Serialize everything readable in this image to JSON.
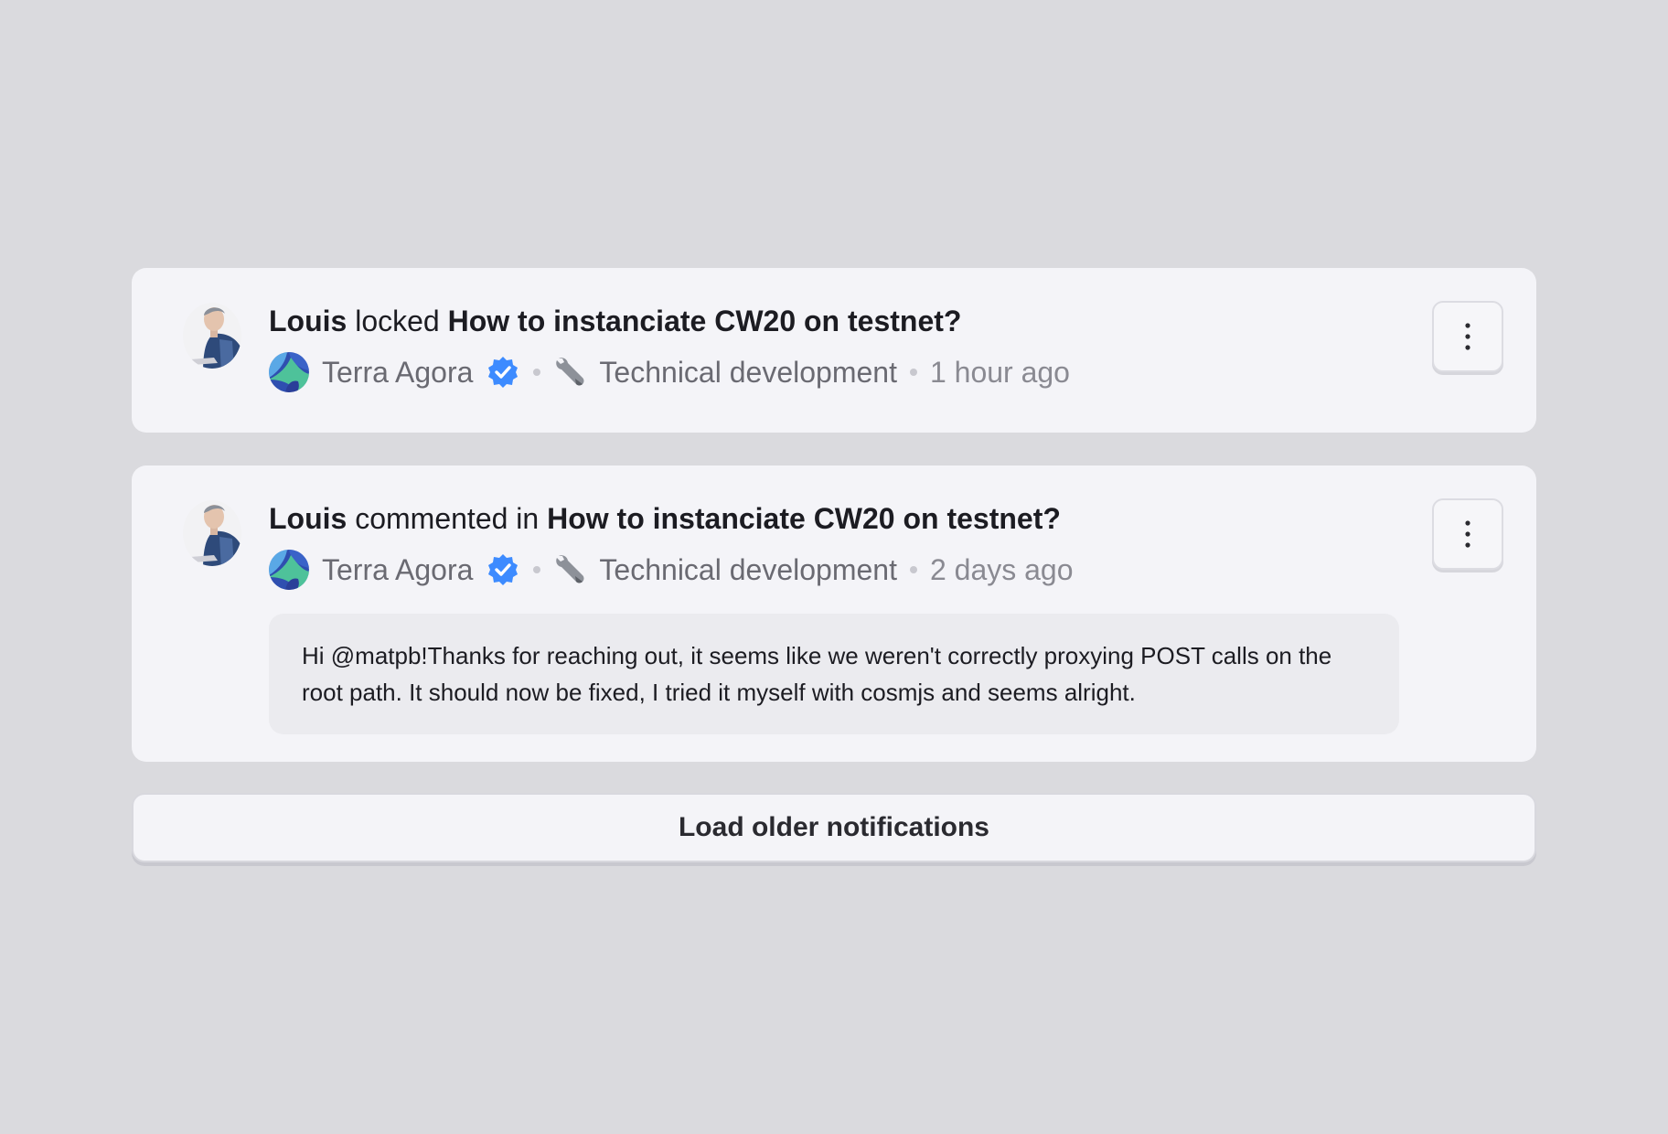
{
  "notifications": [
    {
      "actor": "Louis",
      "action": "locked",
      "target": "How to instanciate CW20 on testnet?",
      "community": "Terra Agora",
      "category": "Technical development",
      "time": "1 hour ago",
      "icons": {
        "avatar": "user-avatar",
        "community": "terra-logo-icon",
        "verified": "verified-badge-icon",
        "category": "wrench-icon",
        "menu": "more-vertical-icon"
      }
    },
    {
      "actor": "Louis",
      "action": "commented in",
      "target": "How to instanciate CW20 on testnet?",
      "community": "Terra Agora",
      "category": "Technical development",
      "time": "2 days ago",
      "comment": "Hi @matpb!Thanks for reaching out, it seems like we weren't correctly proxying POST calls on the root path. It should now be fixed, I tried it myself with cosmjs and seems alright."
    }
  ],
  "load_more_label": "Load older notifications",
  "colors": {
    "background": "#dadade",
    "card": "#f4f4f8",
    "verified": "#3d8bff",
    "muted_text": "#6a6a72"
  }
}
